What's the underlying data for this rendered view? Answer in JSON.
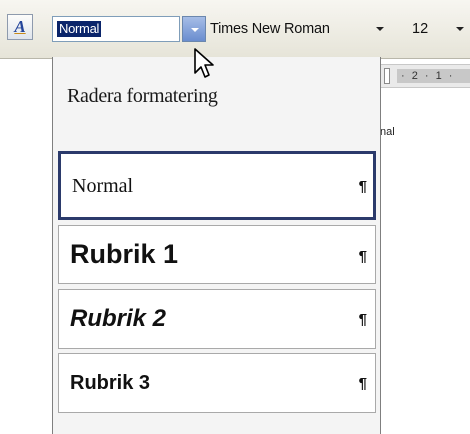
{
  "toolbar": {
    "styles_pane_icon": "styles-and-formatting-icon",
    "styles_pane_glyph": "A",
    "style_value": "Normal",
    "font_value": "Times New Roman",
    "size_value": "12",
    "dropdown_arrow_icon": "chevron-down-icon"
  },
  "document": {
    "ruler_text": "· 2 · 1 ·",
    "partial_text": "nal"
  },
  "style_dropdown": {
    "clear_formatting_label": "Radera formatering",
    "items": [
      {
        "label": "Normal",
        "mark": "¶",
        "selected": true
      },
      {
        "label": "Rubrik 1",
        "mark": "¶"
      },
      {
        "label": "Rubrik 2",
        "mark": "¶"
      },
      {
        "label": "Rubrik 3",
        "mark": "¶"
      }
    ]
  },
  "cursor": {
    "icon": "mouse-pointer-icon"
  },
  "colors": {
    "selection_bg": "#0a246a",
    "dropdown_arrow_bg": "#6a8dcf",
    "selected_item_border": "#2b3a6b"
  }
}
